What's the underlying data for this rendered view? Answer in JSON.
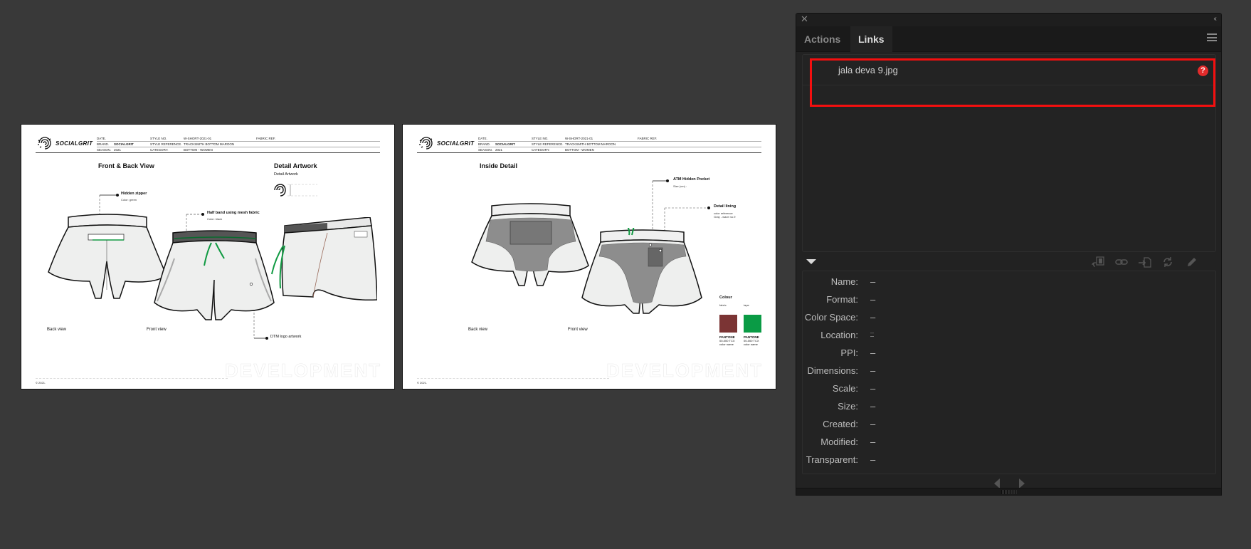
{
  "colors": {
    "canvas": "#393939",
    "panel_bg": "#222222",
    "highlight": "#f40f0f",
    "missing_badge": "#e22b2b",
    "fabric_swatch": "#7b3434",
    "tape_swatch": "#0a9b45",
    "drawcord_green": "#109a42"
  },
  "artboards": [
    {
      "brand": "SOCIALGRIT",
      "header": {
        "date_label": "DATE.",
        "date_value": "",
        "style_no_label": "STYLE NO.",
        "style_no_value": "W-SHORT-2021-01",
        "fabric_ref_label": "FABRIC REF.",
        "brand_label": "BRAND.",
        "brand_value": "SOCIALGRIT",
        "style_ref_label": "STYLE REFERENCE.",
        "style_ref_value": "TRACKSMITH BOTTOM MAROON",
        "season_label": "SEASON.",
        "season_value": "2021",
        "category_label": "CATEGORY.",
        "category_value": "BOTTOM - WOMEN"
      },
      "title": "Front & Back View",
      "detail_title": "Detail Artwork",
      "detail_sub": "Detail Artwork",
      "callouts": [
        {
          "title": "Hidden zipper",
          "note": "Color: green"
        },
        {
          "title": "Half band using mesh fabric",
          "note": "Color: black"
        },
        {
          "title": "DTM logo artwork",
          "note": ""
        }
      ],
      "view_labels": [
        "Back view",
        "Front view"
      ],
      "watermark": "DEVELOPMENT",
      "copyright": "© 2021."
    },
    {
      "brand": "SOCIALGRIT",
      "header": {
        "date_label": "DATE.",
        "date_value": "",
        "style_no_label": "STYLE NO.",
        "style_no_value": "W-SHORT-2021-01",
        "fabric_ref_label": "FABRIC REF.",
        "brand_label": "BRAND.",
        "brand_value": "SOCIALGRIT",
        "style_ref_label": "STYLE REFERENCE.",
        "style_ref_value": "TRACKSMITH BOTTOM MAROON",
        "season_label": "SEASON.",
        "season_value": "2021",
        "category_label": "CATEGORY.",
        "category_value": "BOTTOM - WOMEN"
      },
      "title": "Inside Detail",
      "callouts": [
        {
          "title": "ATM Hidden Pocket",
          "note": "Size (cm) :"
        },
        {
          "title": "Detail lining",
          "note": "color reference\nGray - wave no.9"
        }
      ],
      "colour": {
        "title": "Colour",
        "swatches": [
          {
            "label": "fabric",
            "pantone": "PANTONE",
            "code": "00-000  TCX",
            "name": "color name"
          },
          {
            "label": "tape",
            "pantone": "PANTONE",
            "code": "00-000  TCX",
            "name": "color name"
          }
        ]
      },
      "view_labels": [
        "Back view",
        "Front view"
      ],
      "watermark": "DEVELOPMENT",
      "copyright": "© 2021."
    }
  ],
  "panel": {
    "collapse_glyph": "‹‹",
    "close_glyph": "✕",
    "tabs": [
      {
        "label": "Actions",
        "active": false
      },
      {
        "label": "Links",
        "active": true
      }
    ],
    "links": [
      {
        "name": "jala deva 9.jpg",
        "status": "missing",
        "status_glyph": "?"
      }
    ],
    "toolbar_icons": [
      "relink-from-cc-libraries-icon",
      "relink-icon",
      "go-to-link-icon",
      "update-link-icon",
      "edit-original-icon"
    ],
    "info": [
      {
        "label": "Name:",
        "value": "–"
      },
      {
        "label": "Format:",
        "value": "–"
      },
      {
        "label": "Color Space:",
        "value": "–"
      },
      {
        "label": "Location:",
        "value": "–"
      },
      {
        "label": "PPI:",
        "value": "–"
      },
      {
        "label": "Dimensions:",
        "value": "–"
      },
      {
        "label": "Scale:",
        "value": "–"
      },
      {
        "label": "Size:",
        "value": "–"
      },
      {
        "label": "Created:",
        "value": "–"
      },
      {
        "label": "Modified:",
        "value": "–"
      },
      {
        "label": "Transparent:",
        "value": "–"
      }
    ]
  }
}
